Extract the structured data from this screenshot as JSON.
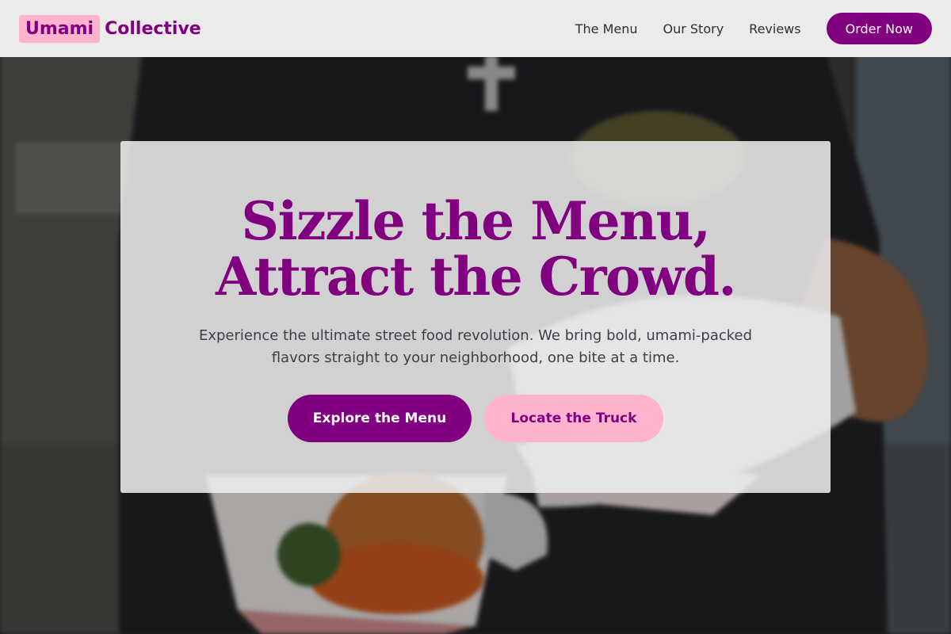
{
  "header": {
    "logo": {
      "word_1": "Umami",
      "word_2": "Collective"
    },
    "nav": [
      {
        "label": "The Menu"
      },
      {
        "label": "Our Story"
      },
      {
        "label": "Reviews"
      }
    ],
    "cta_label": "Order Now"
  },
  "hero": {
    "title_line_1": "Sizzle the Menu,",
    "title_line_2": "Attract the Crowd.",
    "subtitle_line_1": "Experience the ultimate street food revolution. We bring bold, umami-packed",
    "subtitle_line_2": "flavors straight to your neighborhood, one bite at a time.",
    "primary_button": "Explore the Menu",
    "secondary_button": "Locate the Truck",
    "background": "street-food-vendor-photo"
  },
  "colors": {
    "brand_purple": "#800080",
    "brand_pink": "#ffb3cc",
    "header_bg": "#ebebeb",
    "body_text": "#3a3f4a"
  }
}
